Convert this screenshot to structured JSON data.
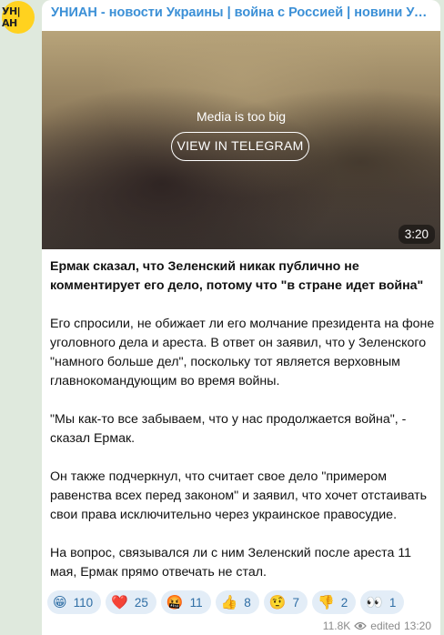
{
  "channel": {
    "name": "УНИАН - новости Украины | война с Россией | новини України | війна з Росією",
    "avatar_text": "УН|АН"
  },
  "media": {
    "notice": "Media is too big",
    "button": "VIEW IN TELEGRAM",
    "duration": "3:20"
  },
  "post": {
    "headline": "Ермак сказал, что Зеленский никак публично не комментирует его дело, потому что \"в стране идет война\"",
    "paragraphs": [
      "Его спросили, не обижает ли его молчание президента на фоне уголовного дела и ареста. В ответ он заявил, что у Зеленского \"намного больше дел\", поскольку тот является верховным главнокомандующим во время войны.",
      "\"Мы как-то все забываем, что у нас продолжается война\", - сказал Ермак.",
      "Он также подчеркнул, что считает свое дело \"примером равенства всех перед законом\" и заявил, что хочет отстаивать свои права исключительно через украинское правосудие.",
      "На вопрос, связывался ли с ним Зеленский после ареста 11 мая, Ермак прямо отвечать не стал."
    ]
  },
  "reactions": [
    {
      "emoji": "😁",
      "count": "110"
    },
    {
      "emoji": "❤️",
      "count": "25"
    },
    {
      "emoji": "🤬",
      "count": "11"
    },
    {
      "emoji": "👍",
      "count": "8"
    },
    {
      "emoji": "🤨",
      "count": "7"
    },
    {
      "emoji": "👎",
      "count": "2"
    },
    {
      "emoji": "👀",
      "count": "1"
    }
  ],
  "footer": {
    "views": "11.8K",
    "edited": "edited",
    "time": "13:20"
  }
}
